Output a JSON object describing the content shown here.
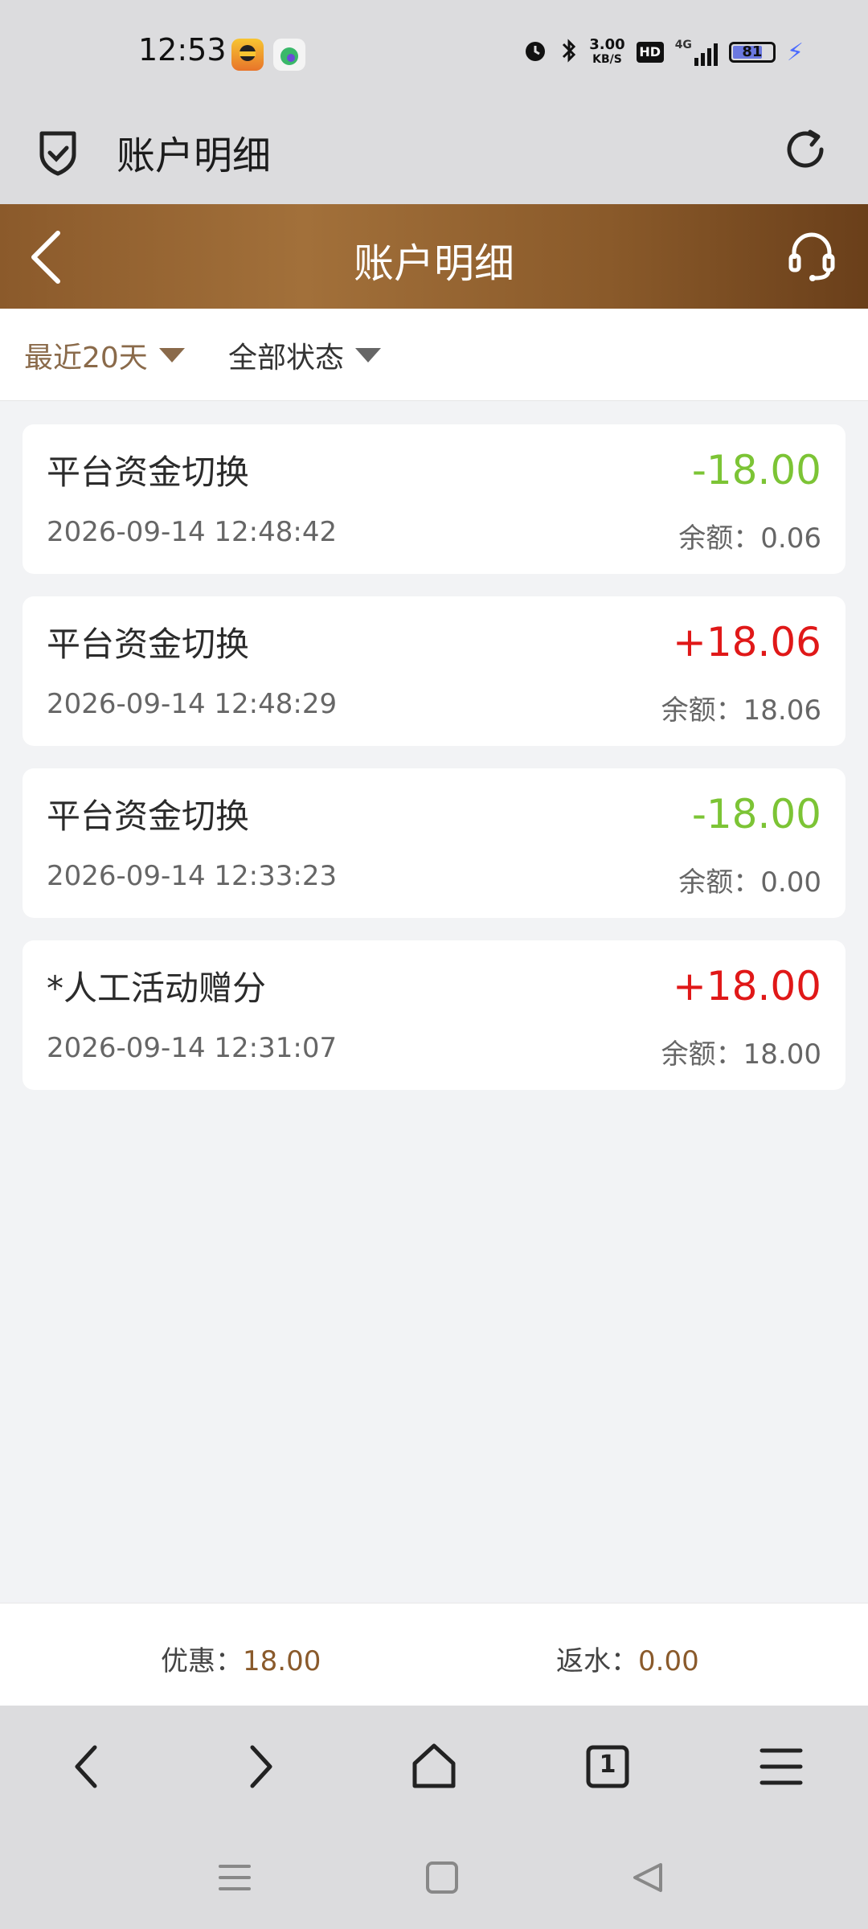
{
  "status_bar": {
    "time": "12:53",
    "net_speed_value": "3.00",
    "net_speed_unit": "KB/S",
    "hd_badge": "HD",
    "signal_label": "4G",
    "battery_level": "81",
    "icons": [
      "alarm-icon",
      "bluetooth-icon",
      "signal-icon",
      "battery-icon",
      "charging-icon"
    ]
  },
  "browser": {
    "title": "账户明细"
  },
  "header": {
    "title": "账户明细"
  },
  "filters": {
    "period": "最近20天",
    "status": "全部状态"
  },
  "records": [
    {
      "title": "平台资金切换",
      "time": "2026-09-14 12:48:42",
      "amount": "-18.00",
      "sign": "neg",
      "balance_label": "余额：",
      "balance": "0.06"
    },
    {
      "title": "平台资金切换",
      "time": "2026-09-14 12:48:29",
      "amount": "+18.06",
      "sign": "pos",
      "balance_label": "余额：",
      "balance": "18.06"
    },
    {
      "title": "平台资金切换",
      "time": "2026-09-14 12:33:23",
      "amount": "-18.00",
      "sign": "neg",
      "balance_label": "余额：",
      "balance": "0.00"
    },
    {
      "title": "*人工活动赠分",
      "time": "2026-09-14 12:31:07",
      "amount": "+18.00",
      "sign": "pos",
      "balance_label": "余额：",
      "balance": "18.00"
    }
  ],
  "summary": {
    "discount_label": "优惠：",
    "discount_value": "18.00",
    "rebate_label": "返水：",
    "rebate_value": "0.00"
  },
  "browser_nav": {
    "tab_count": "1"
  },
  "colors": {
    "header_brown": "#8b5a2b",
    "negative_green": "#7cc435",
    "positive_red": "#e01818",
    "accent_brown": "#8a5a2b"
  }
}
